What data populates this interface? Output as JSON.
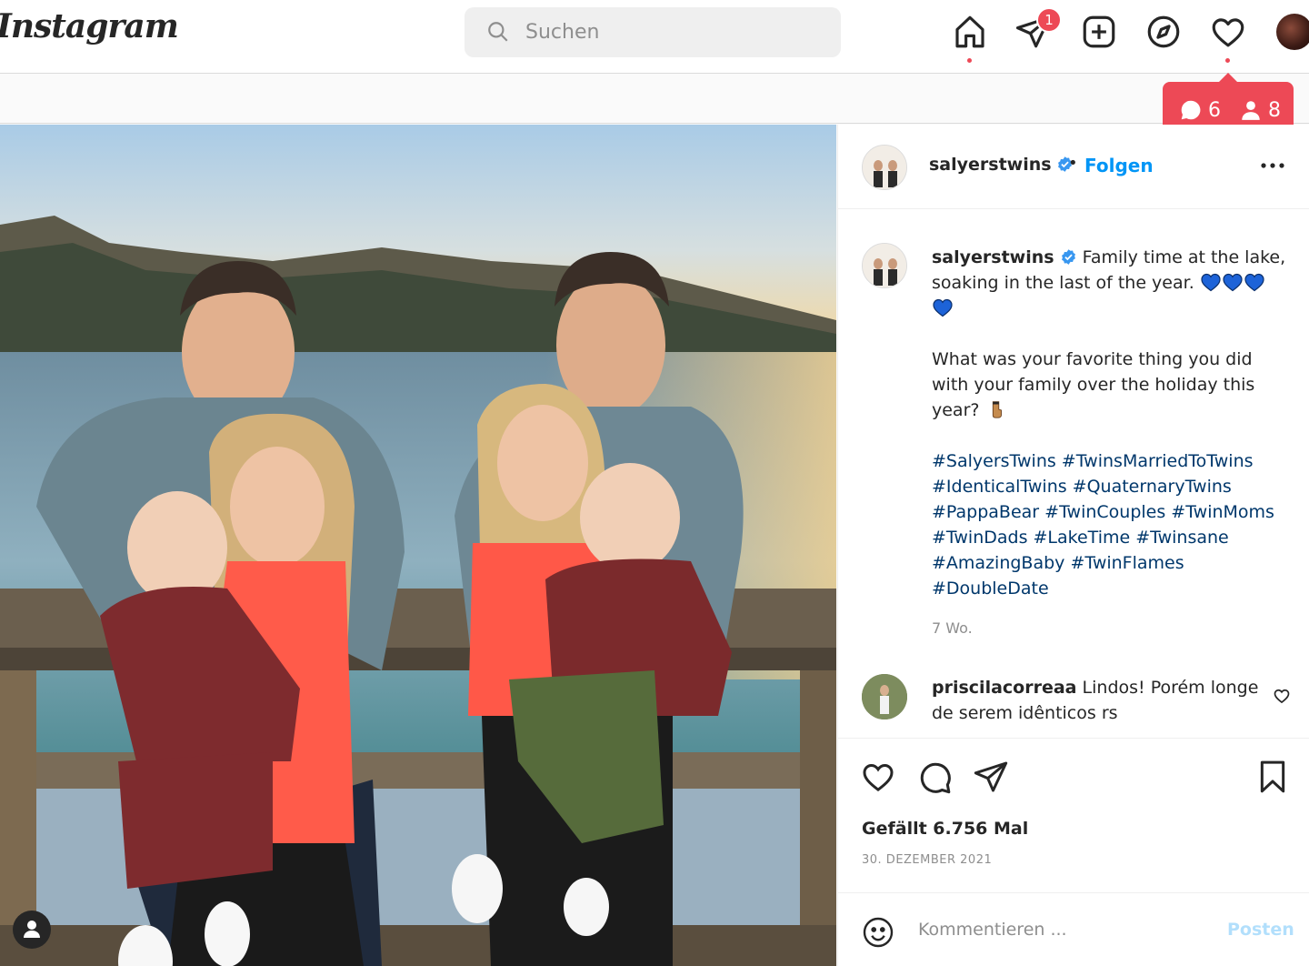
{
  "header": {
    "logo": "Instagram",
    "search_placeholder": "Suchen",
    "direct_badge": "1"
  },
  "notification_popup": {
    "comments": "6",
    "followers": "8"
  },
  "post": {
    "author": "salyerstwins",
    "follow_label": "Folgen",
    "separator": "•",
    "caption": {
      "line1": "Family time at the lake, soaking in the last of the year.",
      "question": "What was your favorite thing you did with your family over the holiday this year?",
      "hashtags": "#SalyersTwins #TwinsMarriedToTwins #IdenticalTwins #QuaternaryTwins #PappaBear #TwinCouples #TwinMoms #TwinDads #LakeTime #Twinsane #AmazingBaby #TwinFlames #DoubleDate",
      "time": "7 Wo."
    },
    "comment": {
      "author": "priscilacorreaa",
      "text": "Lindos! Porém longe de serem idênticos rs"
    },
    "likes": "Gefällt 6.756 Mal",
    "date": "30. DEZEMBER 2021",
    "comment_placeholder": "Kommentieren ...",
    "post_button": "Posten"
  },
  "colors": {
    "accent_blue": "#0095f6",
    "notification_red": "#ed4956",
    "hashtag_blue": "#00376b",
    "heart_emoji_blue": "#1d63d8"
  }
}
